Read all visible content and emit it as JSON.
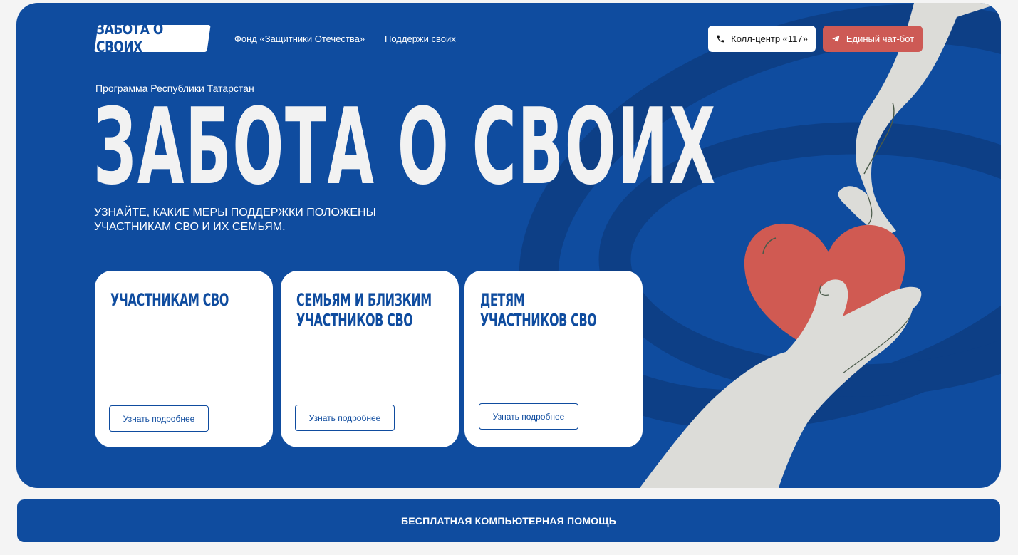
{
  "header": {
    "logo_text": "ЗАБОТА О СВОИХ",
    "nav": [
      "Фонд «Защитники Отечества»",
      "Поддержи своих"
    ],
    "call_center": "Колл-центр «117»",
    "chat_bot": "Единый чат-бот"
  },
  "hero": {
    "program": "Программа Республики Татарстан",
    "title": "ЗАБОТА О СВОИХ",
    "subtitle": "Узнайте, какие меры поддержки положены участникам СВО и их семьям."
  },
  "cards": [
    {
      "title": "Участникам СВО",
      "button": "Узнать подробнее"
    },
    {
      "title": "Семьям и близким участников СВО",
      "button": "Узнать подробнее"
    },
    {
      "title": "Детям участников СВО",
      "button": "Узнать подробнее"
    }
  ],
  "banner": {
    "text": "БЕСПЛАТНАЯ КОМПЬЮТЕРНАЯ ПОМОЩЬ"
  },
  "colors": {
    "brand_blue": "#0f4c9f",
    "accent_red": "#cd5a55",
    "heart": "#d05a52",
    "hands": "#dcdcd8"
  },
  "icons": {
    "call": "phone-icon",
    "bot": "telegram-plane-icon",
    "art": "hands-heart-illustration"
  }
}
